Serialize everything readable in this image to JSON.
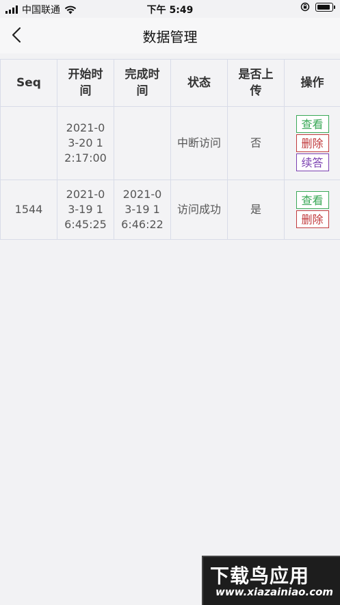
{
  "status_bar": {
    "carrier": "中国联通",
    "time": "下午 5:49"
  },
  "nav": {
    "title": "数据管理"
  },
  "table": {
    "headers": [
      "Seq",
      "开始时间",
      "完成时间",
      "状态",
      "是否上传",
      "操作"
    ],
    "rows": [
      {
        "seq": "",
        "start": "2021-03-20 12:17:00",
        "finish": "",
        "status": "中断访问",
        "uploaded": "否",
        "actions": [
          "查看",
          "删除",
          "续答"
        ]
      },
      {
        "seq": "1544",
        "start": "2021-03-19 16:45:25",
        "finish": "2021-03-19 16:46:22",
        "status": "访问成功",
        "uploaded": "是",
        "actions": [
          "查看",
          "删除"
        ]
      }
    ]
  },
  "colors": {
    "view": "#3aa857",
    "delete": "#c0393b",
    "continue": "#7a3fb0"
  },
  "watermark": {
    "main": "下载鸟应用",
    "sub": "www.xiazainiao.com"
  }
}
